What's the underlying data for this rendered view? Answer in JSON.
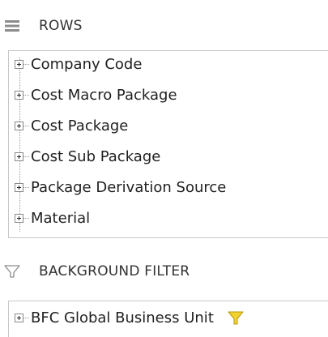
{
  "rows_section": {
    "title": "ROWS",
    "icon": "rows-list-icon",
    "items": [
      {
        "label": "Company Code"
      },
      {
        "label": "Cost Macro Package"
      },
      {
        "label": "Cost Package"
      },
      {
        "label": "Cost Sub Package"
      },
      {
        "label": "Package Derivation Source"
      },
      {
        "label": "Material"
      }
    ]
  },
  "background_filter_section": {
    "title": "BACKGROUND FILTER",
    "icon": "funnel-outline-icon",
    "items": [
      {
        "label": "BFC Global Business Unit",
        "filter_icon": "funnel-filled-icon",
        "filter_color": "#f2d22e"
      }
    ]
  },
  "colors": {
    "border": "#c8c8c8",
    "text": "#1f1f1f",
    "header_text": "#333333",
    "header_icon": "#8c8c8c",
    "filter_active": "#f2d22e"
  }
}
